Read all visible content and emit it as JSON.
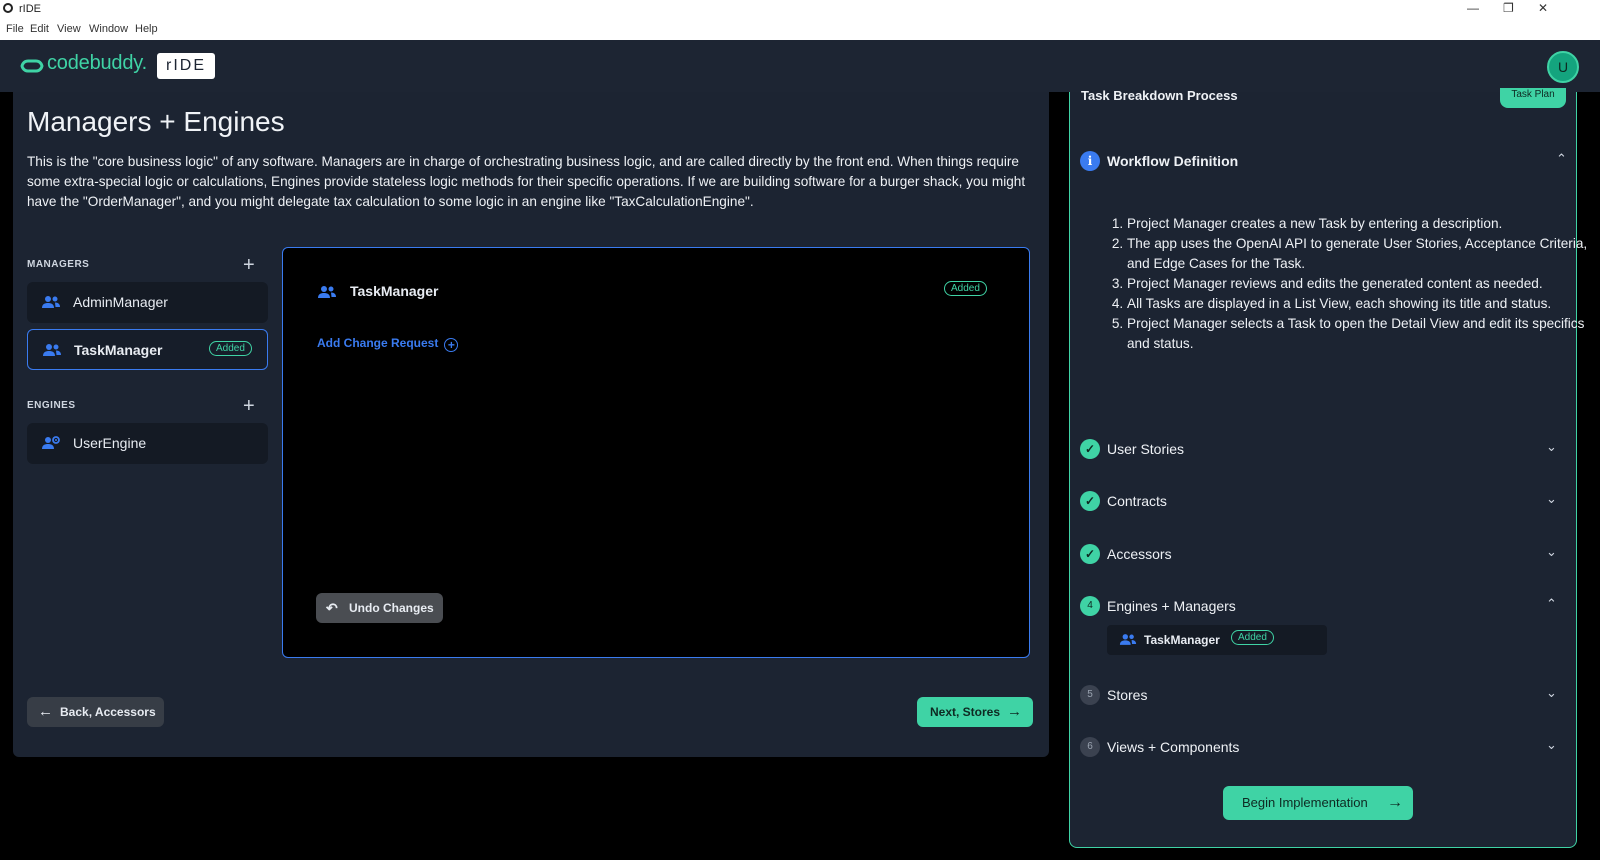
{
  "window": {
    "title": "rIDE",
    "menu": [
      "File",
      "Edit",
      "View",
      "Window",
      "Help"
    ],
    "controls": {
      "minimize": "—",
      "restore": "❐",
      "close": "✕"
    }
  },
  "header": {
    "logo_text": "codebuddy.",
    "product_badge": "rIDE",
    "user_initial": "U"
  },
  "main": {
    "title": "Managers + Engines",
    "intro": "This is the \"core business logic\" of any software. Managers are in charge of orchestrating business logic, and are called directly by the front end. When things require some extra-special logic or calculations, Engines provide stateless logic methods for their specific operations. If we are building software for a burger shack, you might have the \"OrderManager\", and you might delegate tax calculation to some logic in an engine like \"TaxCalculationEngine\".",
    "managers_label": "MANAGERS",
    "engines_label": "ENGINES",
    "add_symbol": "+",
    "managers": [
      {
        "name": "AdminManager"
      },
      {
        "name": "TaskManager",
        "badge": "Added"
      }
    ],
    "engines": [
      {
        "name": "UserEngine"
      }
    ],
    "detail": {
      "name": "TaskManager",
      "badge": "Added",
      "add_change_request": "Add Change Request",
      "undo_label": "Undo Changes"
    },
    "back_label": "Back, Accessors",
    "next_label": "Next, Stores"
  },
  "side": {
    "heading": "Task Breakdown Process",
    "task_plan_tab": "Task Plan",
    "workflow": {
      "title": "Workflow Definition",
      "steps": [
        "Project Manager creates a new Task by entering a description.",
        "The app uses the OpenAI API to generate User Stories, Acceptance Criteria, and Edge Cases for the Task.",
        "Project Manager reviews and edits the generated content as needed.",
        "All Tasks are displayed in a List View, each showing its title and status.",
        "Project Manager selects a Task to open the Detail View and edit its specifics and status."
      ]
    },
    "sections": [
      {
        "label": "User Stories",
        "state": "done"
      },
      {
        "label": "Contracts",
        "state": "done"
      },
      {
        "label": "Accessors",
        "state": "done"
      },
      {
        "label": "Engines + Managers",
        "state": "current",
        "number": "4"
      },
      {
        "label": "Stores",
        "state": "pending",
        "number": "5"
      },
      {
        "label": "Views + Components",
        "state": "pending",
        "number": "6"
      }
    ],
    "engines_managers_items": [
      {
        "name": "TaskManager",
        "badge": "Added"
      }
    ],
    "begin_label": "Begin Implementation"
  },
  "colors": {
    "accent_green": "#3fd3a5",
    "accent_blue": "#3a7bf0",
    "panel_bg": "#1c2432",
    "header_bg": "#1d2533"
  }
}
